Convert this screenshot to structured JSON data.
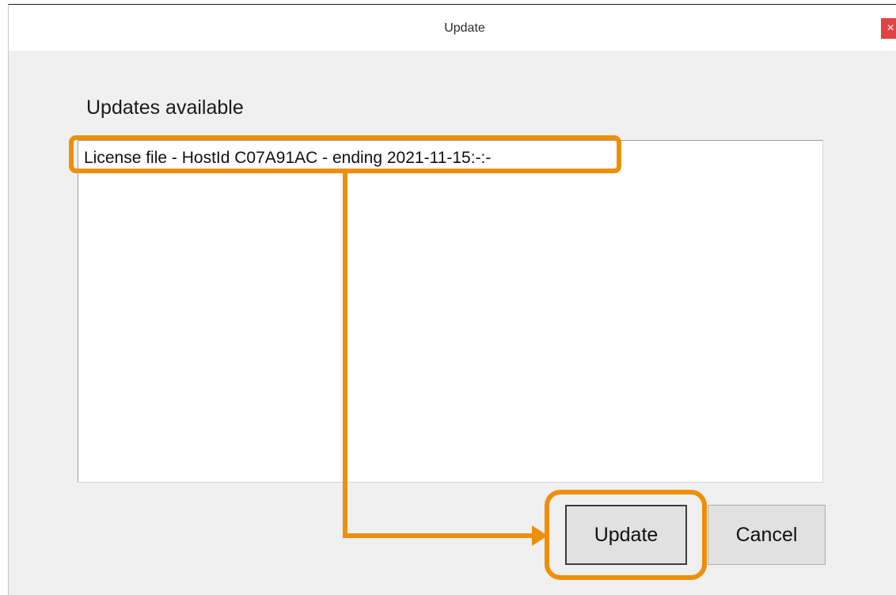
{
  "window": {
    "title": "Update",
    "close_label": "×"
  },
  "dialog": {
    "heading": "Updates available",
    "items": [
      {
        "label": "License file - HostId C07A91AC - ending 2021-11-15:-:-"
      }
    ],
    "buttons": {
      "update_label": "Update",
      "cancel_label": "Cancel"
    }
  },
  "annotation": {
    "highlight_color": "#ee8f0a"
  }
}
